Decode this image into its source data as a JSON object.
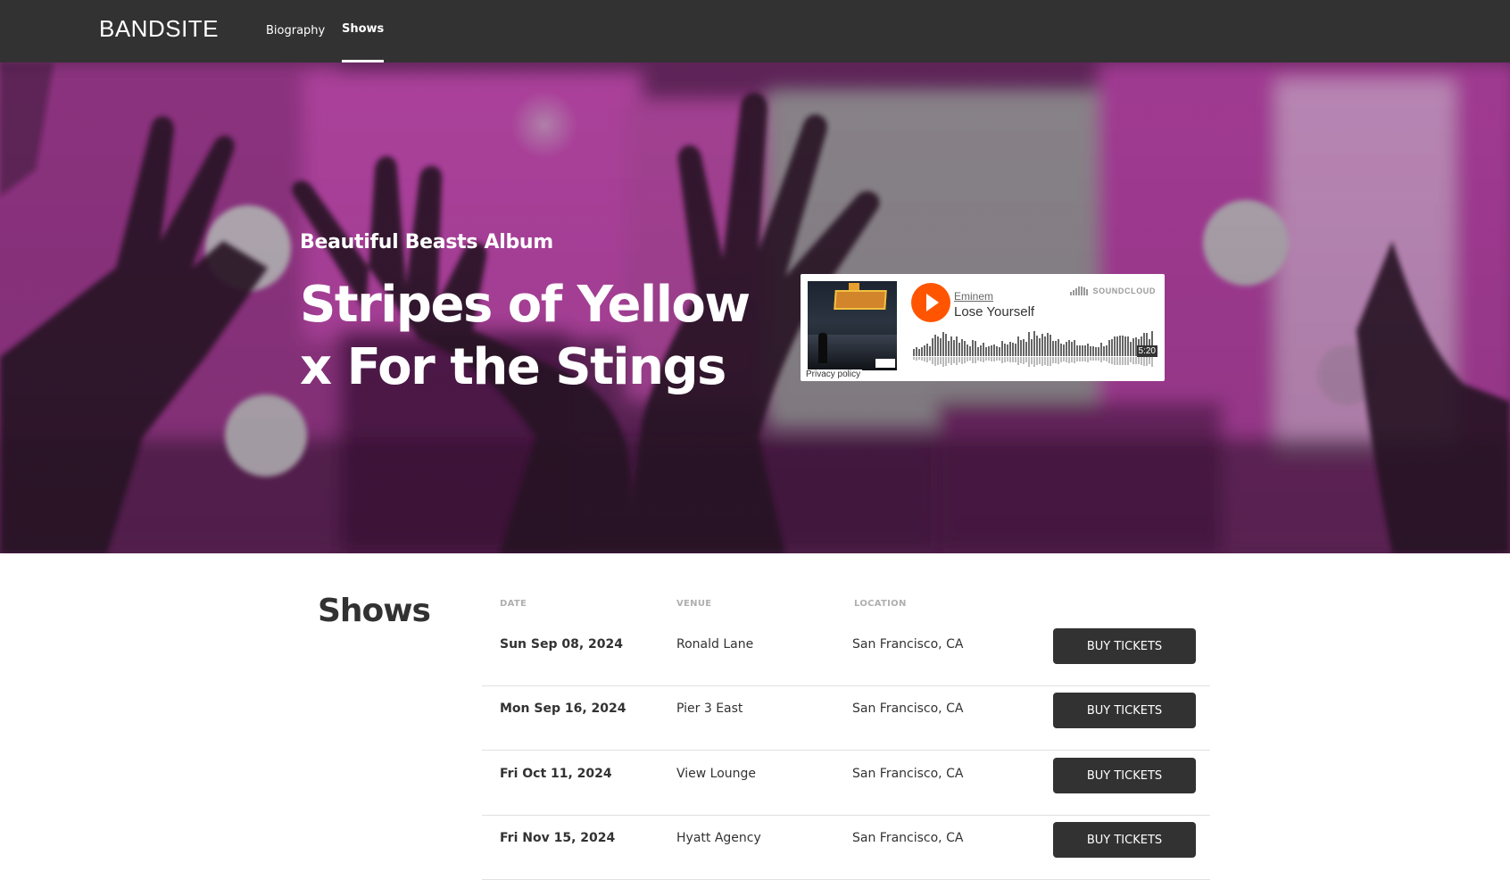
{
  "nav": {
    "logo": "BANDSITE",
    "links": [
      {
        "label": "Biography"
      },
      {
        "label": "Shows"
      }
    ]
  },
  "hero": {
    "subtitle": "Beautiful Beasts Album",
    "title_line1": "Stripes of Yellow",
    "title_line2": "x For the Stings",
    "player": {
      "artist": "Eminem",
      "track": "Lose Yourself",
      "duration": "5:20",
      "brand": "SOUNDCLOUD",
      "privacy": "Privacy policy",
      "play_color": "#ff5500"
    }
  },
  "shows": {
    "heading": "Shows",
    "columns": [
      "DATE",
      "VENUE",
      "LOCATION"
    ],
    "button_label": "BUY TICKETS",
    "rows": [
      {
        "date": "Sun Sep 08, 2024",
        "venue": "Ronald Lane",
        "location": "San Francisco, CA"
      },
      {
        "date": "Mon Sep 16, 2024",
        "venue": "Pier 3 East",
        "location": "San Francisco, CA"
      },
      {
        "date": "Fri Oct 11, 2024",
        "venue": "View Lounge",
        "location": "San Francisco, CA"
      },
      {
        "date": "Fri Nov 15, 2024",
        "venue": "Hyatt Agency",
        "location": "San Francisco, CA"
      }
    ]
  },
  "colors": {
    "nav_bg": "#323232",
    "accent": "#ff5500",
    "button_bg": "#323232",
    "hero_tint": "#b0289e"
  }
}
